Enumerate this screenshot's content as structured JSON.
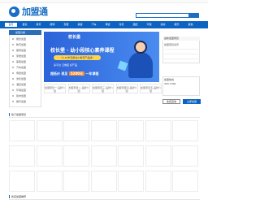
{
  "header": {
    "logo_text": "加盟通",
    "search_placeholder": "",
    "search_button": "",
    "nav": [
      "首页",
      "餐饮",
      "教育",
      "服饰",
      "家居",
      "美容",
      "汽车",
      "母婴",
      "零售",
      "酒店",
      "环保",
      "建材",
      "娱乐",
      "其他"
    ]
  },
  "sidebar": {
    "title": "加盟分类",
    "items": [
      "餐饮加盟",
      "教育加盟",
      "服饰加盟",
      "家居加盟",
      "美容加盟",
      "汽车加盟",
      "母婴加盟",
      "零售加盟",
      "酒店加盟",
      "环保加盟",
      "建材加盟",
      "娱乐加盟"
    ]
  },
  "banner": {
    "brand": "校长堡",
    "title": "校长堡 · 幼小段核心素养课程",
    "pill": "（3-10岁完整幼小教育产品线）",
    "tags": "多平台  五维度  好产品",
    "offer_prefix": "超低价 现至",
    "offer_amount": "5200元",
    "offer_suffix": "一年课程"
  },
  "sub_cards": [
    "加盟项目一 品牌介绍",
    "加盟项目二 品牌介绍",
    "加盟项目三 品牌介绍",
    "加盟项目四 品牌介绍",
    "加盟项目五 品牌介绍"
  ],
  "right": {
    "box_title": "最新加盟项目",
    "box_lines": [
      "加盟项目资讯",
      "",
      "",
      ""
    ],
    "tel_label": "加盟热线",
    "tel_value": "400-1090",
    "btn_left": "免费咨询",
    "btn_right": "立即加盟"
  },
  "section1": {
    "title": "热门加盟项目",
    "cells": [
      "",
      "",
      "",
      "",
      "",
      "",
      "",
      "",
      "",
      "",
      "",
      "",
      "",
      "",
      "",
      "",
      "",
      "",
      "",
      "",
      "",
      "",
      ""
    ]
  },
  "section2": {
    "title": "新店加盟推荐"
  },
  "colors": {
    "brand": "#0d63c1",
    "banner": "#2b63d9",
    "accent": "#ffd34e"
  }
}
